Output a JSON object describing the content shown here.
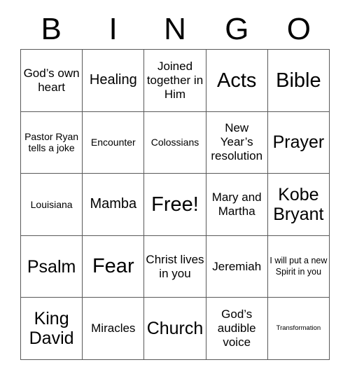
{
  "card": {
    "title": "BINGO",
    "header_letters": [
      "B",
      "I",
      "N",
      "G",
      "O"
    ],
    "grid_size": "5x5",
    "border_color": "#595959",
    "text_color": "#000000",
    "background_color": "#ffffff",
    "free_space": {
      "row": 3,
      "column": 3,
      "label": "Free!"
    },
    "rows": [
      [
        {
          "text": "God’s own heart",
          "size": "md"
        },
        {
          "text": "Healing",
          "size": "lg"
        },
        {
          "text": "Joined together in Him",
          "size": "md"
        },
        {
          "text": "Acts",
          "size": "xxl"
        },
        {
          "text": "Bible",
          "size": "xxl"
        }
      ],
      [
        {
          "text": "Pastor Ryan tells a joke",
          "size": "sm"
        },
        {
          "text": "Encounter",
          "size": "sm"
        },
        {
          "text": "Colossians",
          "size": "sm"
        },
        {
          "text": "New Year’s resolution",
          "size": "md"
        },
        {
          "text": "Prayer",
          "size": "xl"
        }
      ],
      [
        {
          "text": "Louisiana",
          "size": "sm"
        },
        {
          "text": "Mamba",
          "size": "lg"
        },
        {
          "text": "Free!",
          "size": "xxl"
        },
        {
          "text": "Mary and Martha",
          "size": "md"
        },
        {
          "text": "Kobe Bryant",
          "size": "xl"
        }
      ],
      [
        {
          "text": "Psalm",
          "size": "xl"
        },
        {
          "text": "Fear",
          "size": "xxl"
        },
        {
          "text": "Christ lives in you",
          "size": "md"
        },
        {
          "text": "Jeremiah",
          "size": "md"
        },
        {
          "text": "I will put a new Spirit in you",
          "size": "xs"
        }
      ],
      [
        {
          "text": "King David",
          "size": "xl"
        },
        {
          "text": "Miracles",
          "size": "md"
        },
        {
          "text": "Church",
          "size": "xl"
        },
        {
          "text": "God’s audible voice",
          "size": "md"
        },
        {
          "text": "Transformation",
          "size": "xxs"
        }
      ]
    ]
  }
}
